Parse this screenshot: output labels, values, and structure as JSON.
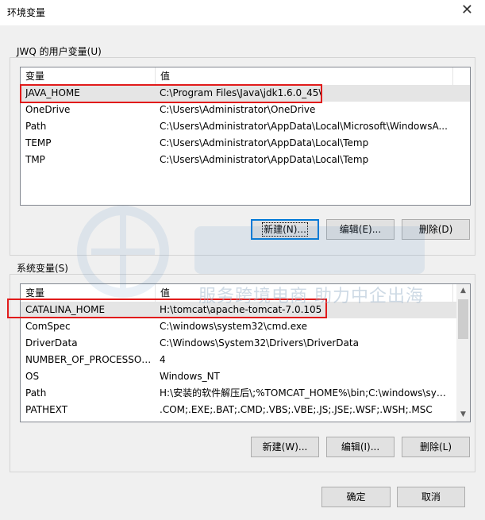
{
  "window": {
    "title": "环境变量",
    "close_glyph": "✕"
  },
  "user_vars": {
    "group_label": "JWQ 的用户变量(U)",
    "columns": [
      "变量",
      "值"
    ],
    "rows": [
      {
        "name": "JAVA_HOME",
        "value": "C:\\Program Files\\Java\\jdk1.6.0_45\\"
      },
      {
        "name": "OneDrive",
        "value": "C:\\Users\\Administrator\\OneDrive"
      },
      {
        "name": "Path",
        "value": "C:\\Users\\Administrator\\AppData\\Local\\Microsoft\\WindowsA..."
      },
      {
        "name": "TEMP",
        "value": "C:\\Users\\Administrator\\AppData\\Local\\Temp"
      },
      {
        "name": "TMP",
        "value": "C:\\Users\\Administrator\\AppData\\Local\\Temp"
      }
    ],
    "buttons": {
      "new": "新建(N)...",
      "edit": "编辑(E)...",
      "delete": "删除(D)"
    }
  },
  "system_vars": {
    "group_label": "系统变量(S)",
    "columns": [
      "变量",
      "值"
    ],
    "rows": [
      {
        "name": "CATALINA_HOME",
        "value": "H:\\tomcat\\apache-tomcat-7.0.105"
      },
      {
        "name": "ComSpec",
        "value": "C:\\windows\\system32\\cmd.exe"
      },
      {
        "name": "DriverData",
        "value": "C:\\Windows\\System32\\Drivers\\DriverData"
      },
      {
        "name": "NUMBER_OF_PROCESSORS",
        "value": "4"
      },
      {
        "name": "OS",
        "value": "Windows_NT"
      },
      {
        "name": "Path",
        "value": "H:\\安装的软件解压后\\;%TOMCAT_HOME%\\bin;C:\\windows\\syst..."
      },
      {
        "name": "PATHEXT",
        "value": ".COM;.EXE;.BAT;.CMD;.VBS;.VBE;.JS;.JSE;.WSF;.WSH;.MSC"
      }
    ],
    "buttons": {
      "new": "新建(W)...",
      "edit": "编辑(I)...",
      "delete": "删除(L)"
    }
  },
  "dialog_buttons": {
    "ok": "确定",
    "cancel": "取消"
  },
  "watermark": {
    "text": "服务跨境电商 助力中企出海"
  },
  "colors": {
    "highlight": "#e11b1b",
    "focus": "#0078d7"
  }
}
